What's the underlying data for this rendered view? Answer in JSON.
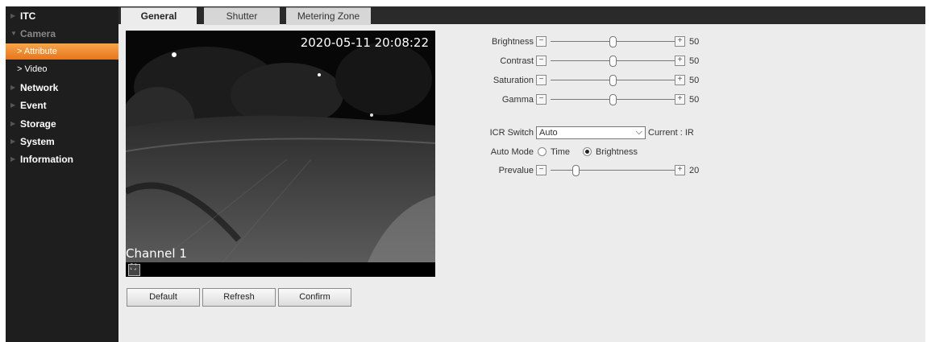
{
  "sidebar": {
    "items": [
      {
        "label": "ITC"
      },
      {
        "label": "Camera"
      },
      {
        "label": "Attribute"
      },
      {
        "label": "Video"
      },
      {
        "label": "Network"
      },
      {
        "label": "Event"
      },
      {
        "label": "Storage"
      },
      {
        "label": "System"
      },
      {
        "label": "Information"
      }
    ]
  },
  "tabs": [
    {
      "label": "General"
    },
    {
      "label": "Shutter"
    },
    {
      "label": "Metering Zone"
    }
  ],
  "video": {
    "timestamp": "2020-05-11 20:08:22",
    "channel": "Channel 1"
  },
  "buttons": {
    "default": "Default",
    "refresh": "Refresh",
    "confirm": "Confirm"
  },
  "sliders": [
    {
      "label": "Brightness",
      "value": "50",
      "fraction": 0.5
    },
    {
      "label": "Contrast",
      "value": "50",
      "fraction": 0.5
    },
    {
      "label": "Saturation",
      "value": "50",
      "fraction": 0.5
    },
    {
      "label": "Gamma",
      "value": "50",
      "fraction": 0.5
    }
  ],
  "icr": {
    "label": "ICR Switch",
    "selected": "Auto",
    "current": "Current : IR"
  },
  "auto_mode": {
    "label": "Auto Mode",
    "options": [
      "Time",
      "Brightness"
    ],
    "selected": "Brightness"
  },
  "prevalue": {
    "label": "Prevalue",
    "value": "20",
    "fraction": 0.2
  }
}
